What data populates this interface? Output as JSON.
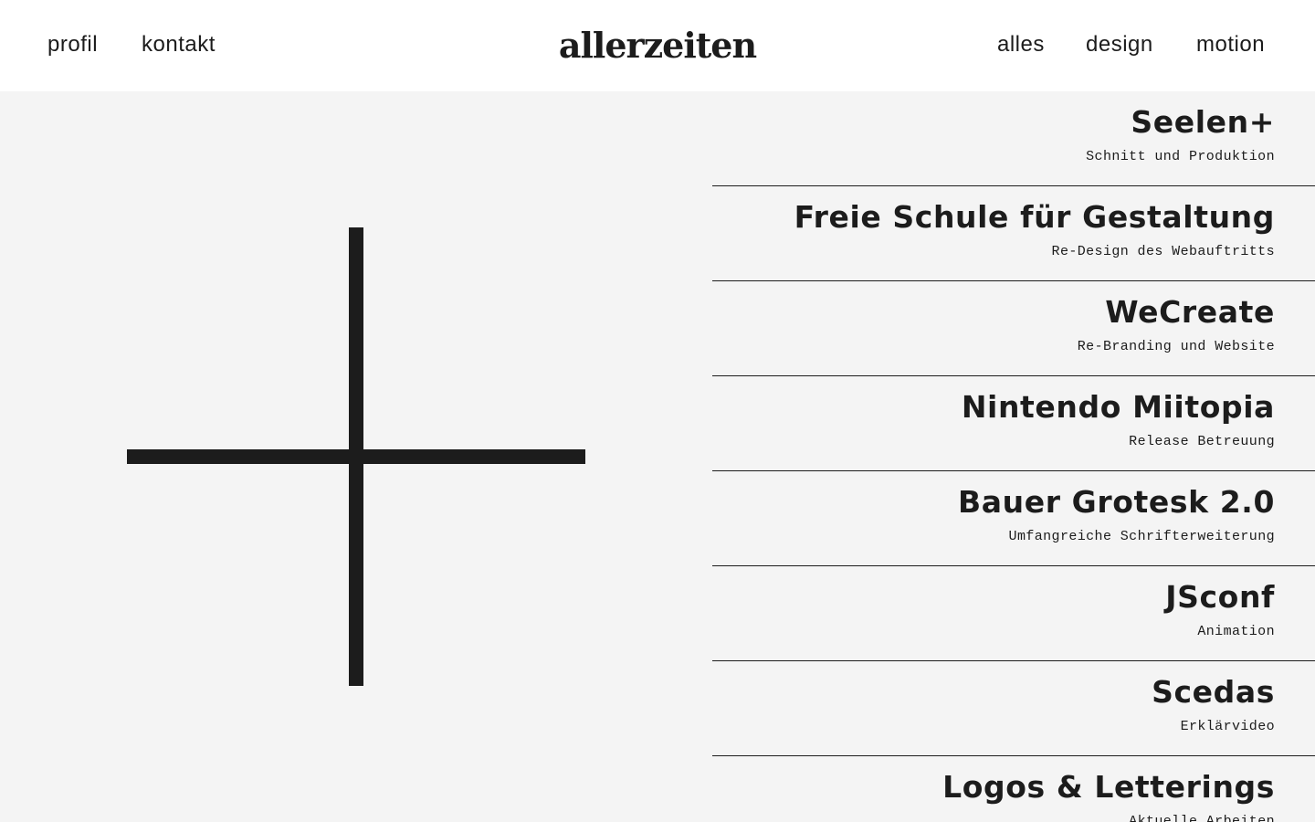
{
  "header": {
    "logo": "allerzeiten",
    "nav_left": [
      "profil",
      "kontakt"
    ],
    "nav_right": [
      "alles",
      "design",
      "motion"
    ]
  },
  "projects": [
    {
      "title": "Seelen+",
      "subtitle": "Schnitt und Produktion"
    },
    {
      "title": "Freie Schule für Gestaltung",
      "subtitle": "Re-Design des Webauftritts"
    },
    {
      "title": "WeCreate",
      "subtitle": "Re-Branding und Website"
    },
    {
      "title": "Nintendo Miitopia",
      "subtitle": "Release Betreuung"
    },
    {
      "title": "Bauer Grotesk 2.0",
      "subtitle": "Umfangreiche Schrifterweiterung"
    },
    {
      "title": "JSconf",
      "subtitle": "Animation"
    },
    {
      "title": "Scedas",
      "subtitle": "Erklärvideo"
    },
    {
      "title": "Logos & Letterings",
      "subtitle": "Aktuelle Arbeiten"
    }
  ],
  "colors": {
    "background": "#f4f4f4",
    "header_background": "#ffffff",
    "ink": "#1c1c1c"
  },
  "icons": {
    "hero": "cross-icon"
  }
}
